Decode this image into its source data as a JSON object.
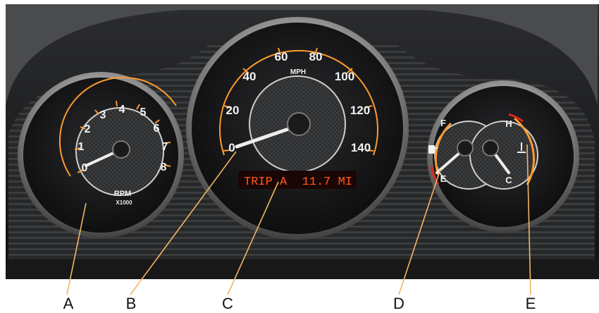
{
  "tachometer": {
    "ticks": [
      "0",
      "1",
      "2",
      "3",
      "4",
      "5",
      "6",
      "7",
      "8"
    ],
    "unit": "RPM",
    "multiplier": "X1000"
  },
  "speedometer": {
    "ticks": [
      "0",
      "20",
      "40",
      "60",
      "80",
      "100",
      "120",
      "140"
    ],
    "unit": "MPH"
  },
  "trip_display": {
    "label": "TRIP A",
    "value": "11.7 MI"
  },
  "fuel_gauge": {
    "full": "F",
    "empty": "E",
    "icon": "fuel-pump-icon"
  },
  "temp_gauge": {
    "hot": "H",
    "cold": "C",
    "icon": "coolant-temperature-icon"
  },
  "callouts": [
    "A",
    "B",
    "C",
    "D",
    "E"
  ],
  "colors": {
    "gauge_backlight": "#ff9a2e",
    "trip_display_text": "#ff5a1f",
    "warning_red": "#e0261a"
  }
}
